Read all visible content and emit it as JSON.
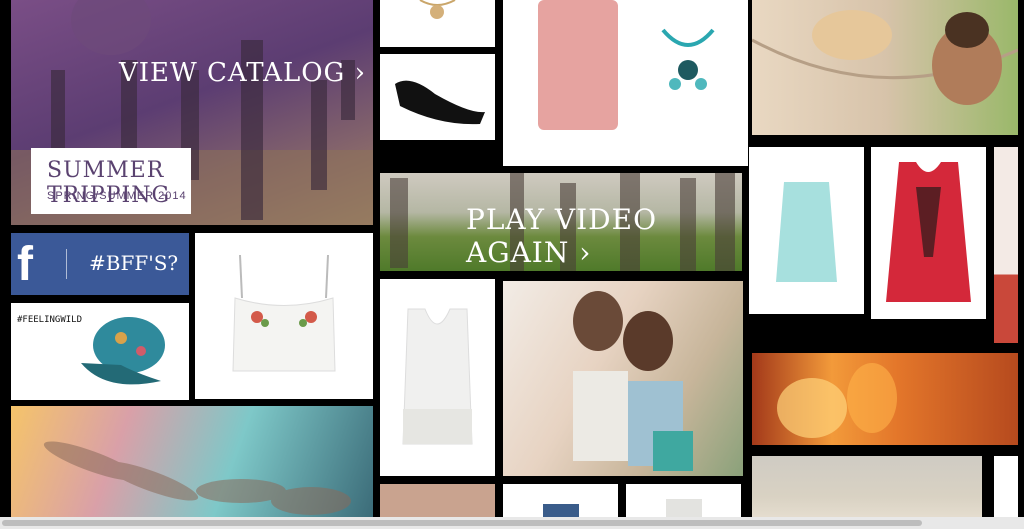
{
  "hero": {
    "cta": "VIEW CATALOG ›",
    "title": "SUMMER TRIPPING",
    "subtitle": "SPRING/SUMMER 2014"
  },
  "video": {
    "cta": "PLAY VIDEO AGAIN ›"
  },
  "social": {
    "facebook_icon": "facebook-icon",
    "hashtag": "#BFF'S?",
    "feeling_tag": "#FEELINGWILD"
  },
  "colors": {
    "facebook_blue": "#3b5998",
    "purple_tint": "#5c3d72"
  }
}
